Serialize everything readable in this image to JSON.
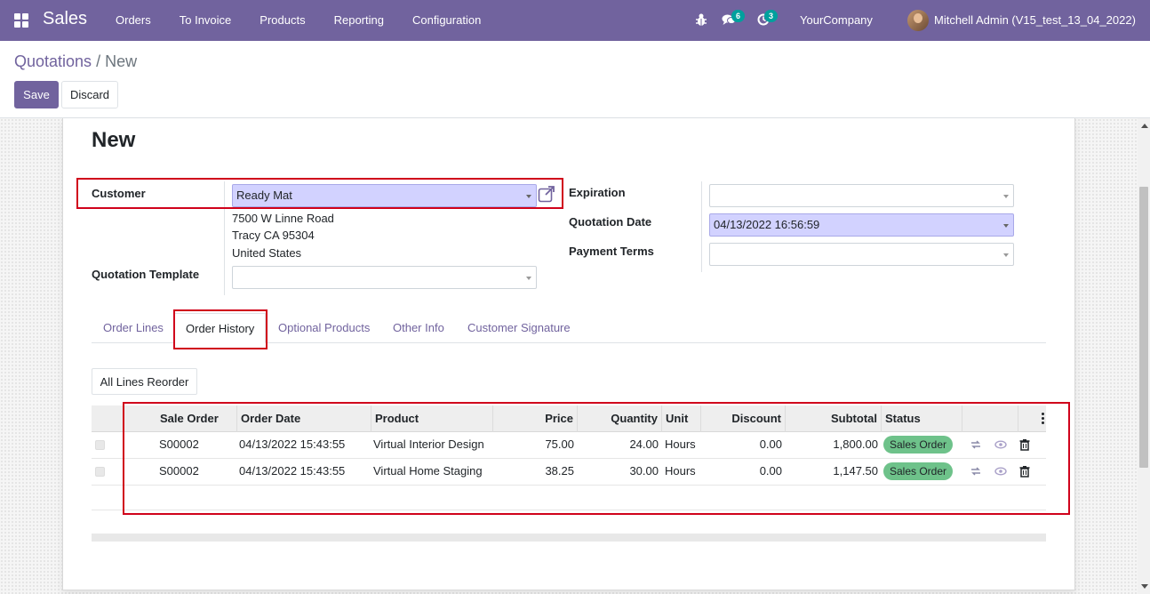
{
  "app": {
    "brand": "Sales",
    "menu": [
      "Orders",
      "To Invoice",
      "Products",
      "Reporting",
      "Configuration"
    ],
    "messages_count": "6",
    "activities_count": "3",
    "company": "YourCompany",
    "user": "Mitchell Admin (V15_test_13_04_2022)"
  },
  "breadcrumb": {
    "parent": "Quotations",
    "separator": " / ",
    "current": "New"
  },
  "actions": {
    "save": "Save",
    "discard": "Discard"
  },
  "form": {
    "title": "New",
    "customer_label": "Customer",
    "customer_value": "Ready Mat",
    "address": [
      "7500 W Linne Road",
      "Tracy CA 95304",
      "United States"
    ],
    "template_label": "Quotation Template",
    "template_value": "",
    "expiration_label": "Expiration",
    "expiration_value": "",
    "quotation_date_label": "Quotation Date",
    "quotation_date_value": "04/13/2022 16:56:59",
    "payment_terms_label": "Payment Terms",
    "payment_terms_value": ""
  },
  "tabs": [
    "Order Lines",
    "Order History",
    "Optional Products",
    "Other Info",
    "Customer Signature"
  ],
  "active_tab": "Order History",
  "reorder_button": "All Lines Reorder",
  "table": {
    "headers": {
      "sale_order": "Sale Order",
      "order_date": "Order Date",
      "product": "Product",
      "price": "Price",
      "quantity": "Quantity",
      "unit": "Unit",
      "discount": "Discount",
      "subtotal": "Subtotal",
      "status": "Status"
    },
    "rows": [
      {
        "sale_order": "S00002",
        "order_date": "04/13/2022 15:43:55",
        "product": "Virtual Interior Design",
        "price": "75.00",
        "quantity": "24.00",
        "unit": "Hours",
        "discount": "0.00",
        "subtotal": "1,800.00",
        "status": "Sales Order"
      },
      {
        "sale_order": "S00002",
        "order_date": "04/13/2022 15:43:55",
        "product": "Virtual Home Staging",
        "price": "38.25",
        "quantity": "30.00",
        "unit": "Hours",
        "discount": "0.00",
        "subtotal": "1,147.50",
        "status": "Sales Order"
      }
    ]
  },
  "colors": {
    "brand": "#71639e",
    "highlight": "#d0021b",
    "status_badge": "#6ec28a",
    "filled_input": "#d2d2ff"
  },
  "icons": [
    "apps-icon",
    "bug-icon",
    "chat-icon",
    "clock-icon",
    "external-link-icon",
    "reorder-icon",
    "view-icon",
    "trash-icon",
    "kebab-icon"
  ]
}
